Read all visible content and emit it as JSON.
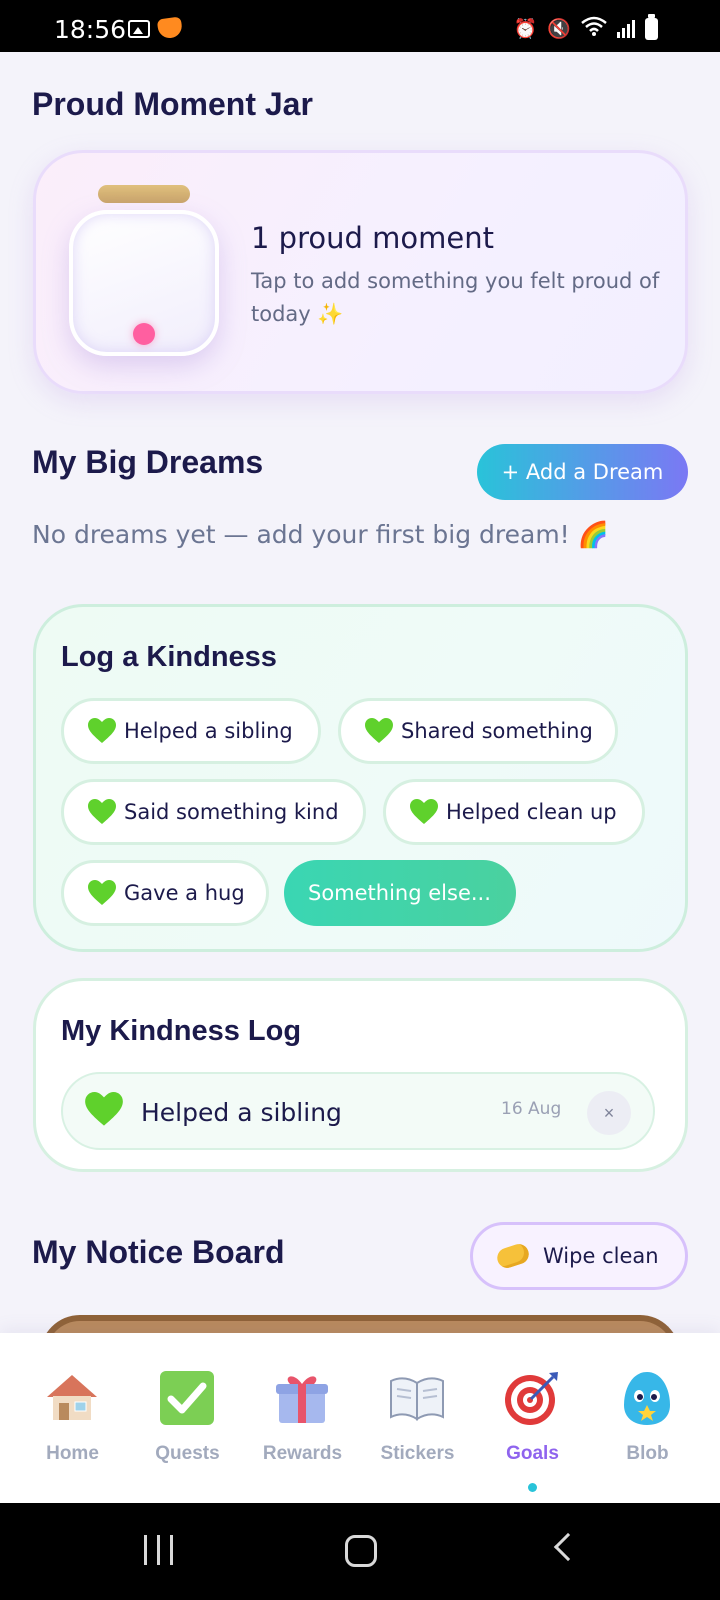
{
  "status_bar": {
    "time": "18:56"
  },
  "jar": {
    "title": "Proud Moment Jar",
    "count_text": "1 proud moment",
    "hint_text": "Tap to add something you felt proud of today",
    "hint_emoji": "✨"
  },
  "dreams": {
    "title": "My Big Dreams",
    "add_label": "+ Add a Dream",
    "empty_text": "No dreams yet — add your first big dream!",
    "empty_emoji": "🌈"
  },
  "kindness": {
    "title": "Log a Kindness",
    "chips": [
      {
        "label": "Helped a sibling",
        "icon": "green-heart-icon"
      },
      {
        "label": "Shared something",
        "icon": "green-heart-icon"
      },
      {
        "label": "Said something kind",
        "icon": "green-heart-icon"
      },
      {
        "label": "Helped clean up",
        "icon": "green-heart-icon"
      },
      {
        "label": "Gave a hug",
        "icon": "green-heart-icon"
      }
    ],
    "other_label": "Something else..."
  },
  "kindness_log": {
    "title": "My Kindness Log",
    "entries": [
      {
        "text": "Helped a sibling",
        "date": "16 Aug",
        "remove_label": "×",
        "icon": "green-heart-icon"
      }
    ]
  },
  "notice_board": {
    "title": "My Notice Board",
    "wipe_label": "Wipe clean",
    "wipe_icon": "sponge-icon"
  },
  "bottom_nav": {
    "active": "Goals",
    "items": [
      {
        "label": "Home",
        "icon": "house-icon"
      },
      {
        "label": "Quests",
        "icon": "check-mark-icon"
      },
      {
        "label": "Rewards",
        "icon": "gift-icon"
      },
      {
        "label": "Stickers",
        "icon": "book-icon"
      },
      {
        "label": "Goals",
        "icon": "target-icon"
      },
      {
        "label": "Blob",
        "icon": "blob-mascot-icon"
      }
    ]
  },
  "colors": {
    "title": "#1c1a4b",
    "accent_purple": "#8f64ee",
    "accent_teal": "#29c3d9",
    "kindness_green": "#3ad6b3",
    "jar_dot": "#ff5fa0"
  }
}
